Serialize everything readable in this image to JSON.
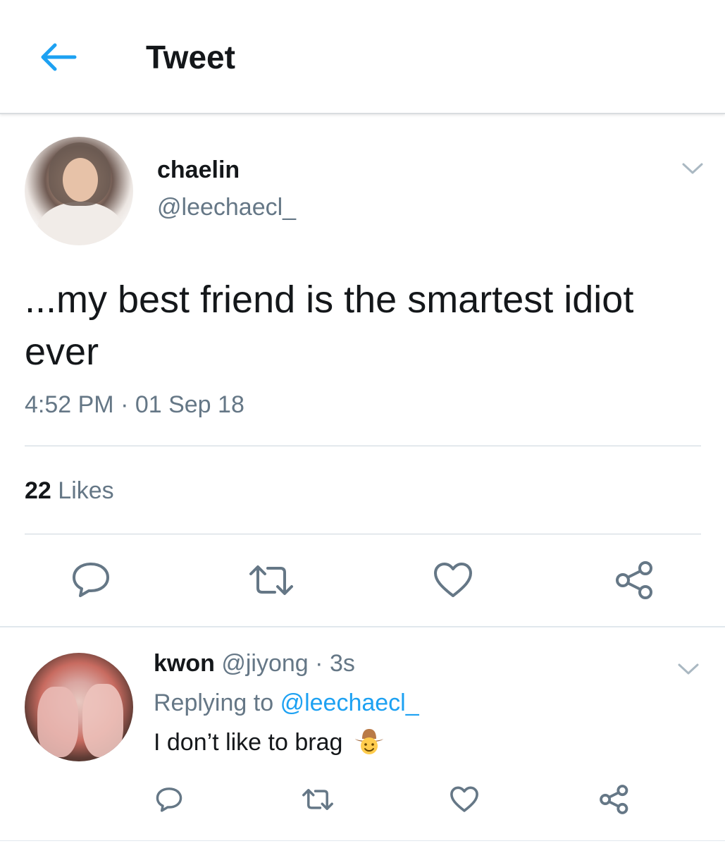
{
  "header": {
    "title": "Tweet",
    "back_icon": "arrow-left-icon",
    "accent": "#1da1f2"
  },
  "tweet": {
    "author_name": "chaelin",
    "author_handle": "@leechaecl_",
    "text": "...my best friend is the smartest idiot ever",
    "timestamp": "4:52 PM · 01 Sep 18",
    "likes_count": "22",
    "likes_label": "Likes",
    "actions": [
      "reply-icon",
      "retweet-icon",
      "like-icon",
      "share-icon"
    ]
  },
  "reply": {
    "author_name": "kwon",
    "author_handle": "@jiyong",
    "time": "· 3s",
    "replying_prefix": "Replying to",
    "replying_handle": "@leechaecl_",
    "text": "I don’t like to brag",
    "emoji": "cowboy-face-icon",
    "actions": [
      "reply-icon",
      "retweet-icon",
      "like-icon",
      "share-icon"
    ]
  },
  "colors": {
    "text": "#14171a",
    "secondary": "#657786",
    "link": "#1da1f2",
    "divider": "#ccd6dd"
  }
}
